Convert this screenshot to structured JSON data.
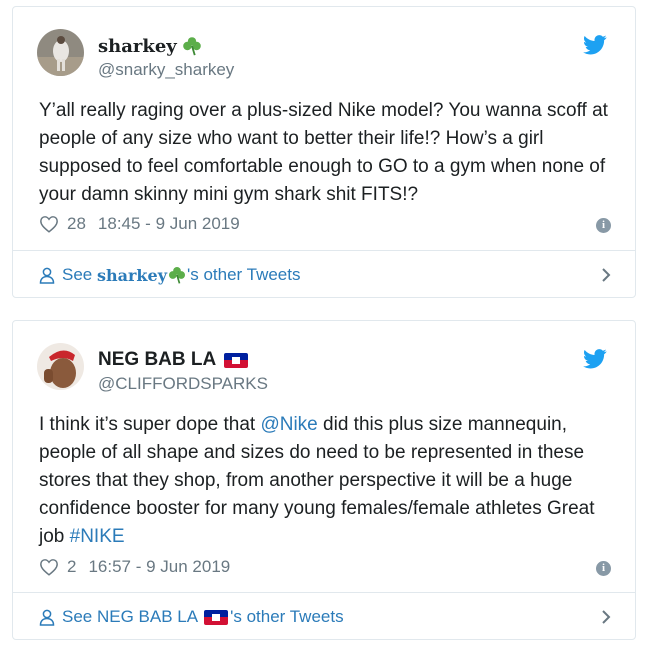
{
  "tweets": [
    {
      "author_name": "sharkey",
      "author_emoji": "shamrock-icon",
      "handle": "@snarky_sharkey",
      "text": "Y’all really raging over a plus-sized Nike model? You wanna scoff at people of any size who want to better their life!? How’s a girl supposed to feel comfortable enough to GO to a gym when none of your damn skinny mini gym shark shit FITS!?",
      "likes": "28",
      "timestamp": "18:45 - 9 Jun 2019",
      "footer_prefix": "See ",
      "footer_name": "sharkey",
      "footer_suffix": "'s other Tweets"
    },
    {
      "author_name": "NEG BAB LA",
      "author_emoji": "haiti-flag-icon",
      "handle": "@CLIFFORDSPARKS",
      "text_parts": {
        "p1": "I think it’s super dope that ",
        "mention": "@Nike",
        "p2": " did this plus size mannequin, people of all shape and sizes do need to be represented in these stores that they shop, from another perspective it will be a huge confidence booster for many young females/female athletes Great job ",
        "hashtag": "#NIKE"
      },
      "likes": "2",
      "timestamp": "16:57 - 9 Jun 2019",
      "footer_prefix": "See ",
      "footer_name": "NEG BAB LA",
      "footer_suffix": "'s other Tweets"
    }
  ],
  "colors": {
    "link": "#2b7bb9",
    "muted": "#697882",
    "border": "#e1e8ed",
    "twitter_blue": "#1da1f2",
    "shamrock": "#5cae4a"
  }
}
